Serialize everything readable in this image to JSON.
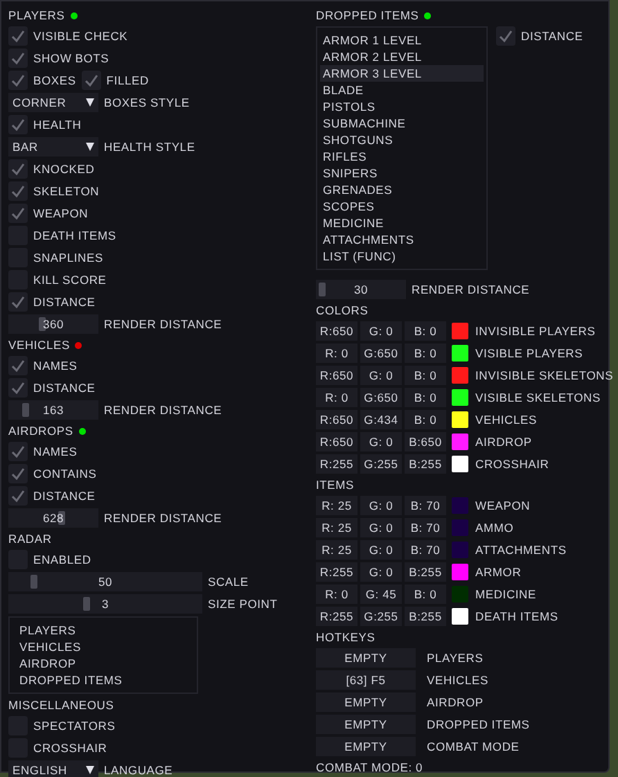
{
  "left_sections": [
    {
      "title": "PLAYERS",
      "color": "#00e000",
      "rows": [
        {
          "kind": "check",
          "label": "VISIBLE CHECK",
          "checked": true
        },
        {
          "kind": "check",
          "label": "SHOW BOTS",
          "checked": true
        },
        {
          "kind": "check_pair",
          "items": [
            {
              "label": "BOXES",
              "checked": true
            },
            {
              "label": "FILLED",
              "checked": true
            }
          ]
        },
        {
          "kind": "dropdown",
          "option": "CORNER",
          "label": "BOXES STYLE"
        },
        {
          "kind": "check",
          "label": "HEALTH",
          "checked": true
        },
        {
          "kind": "dropdown",
          "option": "BAR",
          "label": "HEALTH STYLE"
        },
        {
          "kind": "check",
          "label": "KNOCKED",
          "checked": true
        },
        {
          "kind": "check",
          "label": "SKELETON",
          "checked": true
        },
        {
          "kind": "check",
          "label": "WEAPON",
          "checked": true
        },
        {
          "kind": "check",
          "label": "DEATH ITEMS",
          "checked": false
        },
        {
          "kind": "check",
          "label": "SNAPLINES",
          "checked": false
        },
        {
          "kind": "check",
          "label": "KILL SCORE",
          "checked": false
        },
        {
          "kind": "check",
          "label": "DISTANCE",
          "checked": true
        },
        {
          "kind": "slider",
          "reading": "360",
          "level": 0.36,
          "label": "RENDER DISTANCE"
        }
      ]
    },
    {
      "title": "VEHICLES",
      "color": "#e00000",
      "rows": [
        {
          "kind": "check",
          "label": "NAMES",
          "checked": true
        },
        {
          "kind": "check",
          "label": "DISTANCE",
          "checked": true
        },
        {
          "kind": "slider",
          "reading": "163",
          "level": 0.16,
          "label": "RENDER DISTANCE"
        }
      ]
    },
    {
      "title": "AIRDROPS",
      "color": "#00e000",
      "rows": [
        {
          "kind": "check",
          "label": "NAMES",
          "checked": true
        },
        {
          "kind": "check",
          "label": "CONTAINS",
          "checked": true
        },
        {
          "kind": "check",
          "label": "DISTANCE",
          "checked": true
        },
        {
          "kind": "slider",
          "reading": "628",
          "level": 0.6,
          "label": "RENDER DISTANCE"
        }
      ]
    },
    {
      "title": "RADAR",
      "rows": [
        {
          "kind": "check",
          "label": "ENABLED",
          "checked": false
        },
        {
          "kind": "wide_slider",
          "reading": "50",
          "level": 0.12,
          "label": "SCALE"
        },
        {
          "kind": "wide_slider",
          "reading": "3",
          "level": 0.4,
          "label": "SIZE POINT"
        },
        {
          "kind": "list",
          "items": [
            {
              "label": "PLAYERS",
              "selected": false
            },
            {
              "label": "VEHICLES",
              "selected": false
            },
            {
              "label": "AIRDROP",
              "selected": false
            },
            {
              "label": "DROPPED ITEMS",
              "selected": false
            }
          ]
        }
      ]
    },
    {
      "title": "MISCELLANEOUS",
      "rows": [
        {
          "kind": "check",
          "label": "SPECTATORS",
          "checked": false
        },
        {
          "kind": "check",
          "label": "CROSSHAIR",
          "checked": false
        },
        {
          "kind": "dropdown",
          "option": "ENGLISH",
          "label": "LANGUAGE"
        }
      ]
    }
  ],
  "dropped_items": {
    "title": "DROPPED ITEMS",
    "color": "#00e000",
    "items": [
      {
        "label": "ARMOR 1 LEVEL",
        "selected": false
      },
      {
        "label": "ARMOR 2 LEVEL",
        "selected": false
      },
      {
        "label": "ARMOR 3 LEVEL",
        "selected": true
      },
      {
        "label": "BLADE",
        "selected": false
      },
      {
        "label": "PISTOLS",
        "selected": false
      },
      {
        "label": "SUBMACHINE",
        "selected": false
      },
      {
        "label": "SHOTGUNS",
        "selected": false
      },
      {
        "label": "RIFLES",
        "selected": false
      },
      {
        "label": "SNIPERS",
        "selected": false
      },
      {
        "label": "GRENADES",
        "selected": false
      },
      {
        "label": "SCOPES",
        "selected": false
      },
      {
        "label": "MEDICINE",
        "selected": false
      },
      {
        "label": "ATTACHMENTS",
        "selected": false
      },
      {
        "label": "LIST (FUNC)",
        "selected": false
      }
    ],
    "distance": {
      "label": "DISTANCE",
      "checked": true
    },
    "slider": {
      "reading": "30",
      "level": 0.03,
      "label": "RENDER DISTANCE"
    }
  },
  "colors": {
    "title": "COLORS",
    "rows": [
      {
        "r": "R:650",
        "g": "G: 0",
        "b": "B: 0",
        "color": "#ff1a1a",
        "label": "INVISIBLE PLAYERS"
      },
      {
        "r": "R: 0",
        "g": "G:650",
        "b": "B: 0",
        "color": "#1aff1a",
        "label": "VISIBLE PLAYERS"
      },
      {
        "r": "R:650",
        "g": "G: 0",
        "b": "B: 0",
        "color": "#ff1a1a",
        "label": "INVISIBLE SKELETONS"
      },
      {
        "r": "R: 0",
        "g": "G:650",
        "b": "B: 0",
        "color": "#1aff1a",
        "label": "VISIBLE SKELETONS"
      },
      {
        "r": "R:650",
        "g": "G:434",
        "b": "B: 0",
        "color": "#ffff1a",
        "label": "VEHICLES"
      },
      {
        "r": "R:650",
        "g": "G: 0",
        "b": "B:650",
        "color": "#ff1aff",
        "label": "AIRDROP"
      },
      {
        "r": "R:255",
        "g": "G:255",
        "b": "B:255",
        "color": "#ffffff",
        "label": "CROSSHAIR"
      }
    ]
  },
  "items": {
    "title": "ITEMS",
    "rows": [
      {
        "r": "R: 25",
        "g": "G: 0",
        "b": "B: 70",
        "color": "#190046",
        "label": "WEAPON"
      },
      {
        "r": "R: 25",
        "g": "G: 0",
        "b": "B: 70",
        "color": "#190046",
        "label": "AMMO"
      },
      {
        "r": "R: 25",
        "g": "G: 0",
        "b": "B: 70",
        "color": "#190046",
        "label": "ATTACHMENTS"
      },
      {
        "r": "R:255",
        "g": "G: 0",
        "b": "B:255",
        "color": "#ff00ff",
        "label": "ARMOR"
      },
      {
        "r": "R: 0",
        "g": "G: 45",
        "b": "B: 0",
        "color": "#002d00",
        "label": "MEDICINE"
      },
      {
        "r": "R:255",
        "g": "G:255",
        "b": "B:255",
        "color": "#ffffff",
        "label": "DEATH ITEMS"
      }
    ]
  },
  "hotkeys": {
    "title": "HOTKEYS",
    "rows": [
      {
        "key": "EMPTY",
        "label": "PLAYERS"
      },
      {
        "key": "[63] F5",
        "label": "VEHICLES"
      },
      {
        "key": "EMPTY",
        "label": "AIRDROP"
      },
      {
        "key": "EMPTY",
        "label": "DROPPED ITEMS"
      },
      {
        "key": "EMPTY",
        "label": "COMBAT MODE"
      }
    ]
  },
  "combat_mode": "COMBAT MODE: 0"
}
